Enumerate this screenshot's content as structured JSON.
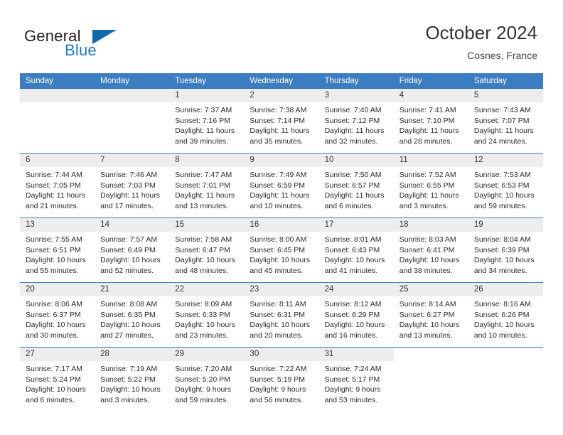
{
  "brand": {
    "word_one": "General",
    "word_two": "Blue",
    "triangle_color": "#1069ad",
    "blue_color": "#1f7bc1"
  },
  "header": {
    "title": "October 2024",
    "location": "Cosnes, France"
  },
  "theme": {
    "header_blue": "#3b7dc0",
    "daynum_gray": "#ededed",
    "text": "#2b2b2b"
  },
  "calendar": {
    "weekday_headers": [
      "Sunday",
      "Monday",
      "Tuesday",
      "Wednesday",
      "Thursday",
      "Friday",
      "Saturday"
    ],
    "labels": {
      "sunrise": "Sunrise:",
      "sunset": "Sunset:",
      "daylight": "Daylight:"
    },
    "weeks": [
      [
        {
          "day": "",
          "empty": true,
          "sunrise": "",
          "sunset": "",
          "daylight": ""
        },
        {
          "day": "",
          "empty": true,
          "sunrise": "",
          "sunset": "",
          "daylight": ""
        },
        {
          "day": "1",
          "sunrise": "Sunrise: 7:37 AM",
          "sunset": "Sunset: 7:16 PM",
          "daylight": "Daylight: 11 hours and 39 minutes."
        },
        {
          "day": "2",
          "sunrise": "Sunrise: 7:38 AM",
          "sunset": "Sunset: 7:14 PM",
          "daylight": "Daylight: 11 hours and 35 minutes."
        },
        {
          "day": "3",
          "sunrise": "Sunrise: 7:40 AM",
          "sunset": "Sunset: 7:12 PM",
          "daylight": "Daylight: 11 hours and 32 minutes."
        },
        {
          "day": "4",
          "sunrise": "Sunrise: 7:41 AM",
          "sunset": "Sunset: 7:10 PM",
          "daylight": "Daylight: 11 hours and 28 minutes."
        },
        {
          "day": "5",
          "sunrise": "Sunrise: 7:43 AM",
          "sunset": "Sunset: 7:07 PM",
          "daylight": "Daylight: 11 hours and 24 minutes."
        }
      ],
      [
        {
          "day": "6",
          "sunrise": "Sunrise: 7:44 AM",
          "sunset": "Sunset: 7:05 PM",
          "daylight": "Daylight: 11 hours and 21 minutes."
        },
        {
          "day": "7",
          "sunrise": "Sunrise: 7:46 AM",
          "sunset": "Sunset: 7:03 PM",
          "daylight": "Daylight: 11 hours and 17 minutes."
        },
        {
          "day": "8",
          "sunrise": "Sunrise: 7:47 AM",
          "sunset": "Sunset: 7:01 PM",
          "daylight": "Daylight: 11 hours and 13 minutes."
        },
        {
          "day": "9",
          "sunrise": "Sunrise: 7:49 AM",
          "sunset": "Sunset: 6:59 PM",
          "daylight": "Daylight: 11 hours and 10 minutes."
        },
        {
          "day": "10",
          "sunrise": "Sunrise: 7:50 AM",
          "sunset": "Sunset: 6:57 PM",
          "daylight": "Daylight: 11 hours and 6 minutes."
        },
        {
          "day": "11",
          "sunrise": "Sunrise: 7:52 AM",
          "sunset": "Sunset: 6:55 PM",
          "daylight": "Daylight: 11 hours and 3 minutes."
        },
        {
          "day": "12",
          "sunrise": "Sunrise: 7:53 AM",
          "sunset": "Sunset: 6:53 PM",
          "daylight": "Daylight: 10 hours and 59 minutes."
        }
      ],
      [
        {
          "day": "13",
          "sunrise": "Sunrise: 7:55 AM",
          "sunset": "Sunset: 6:51 PM",
          "daylight": "Daylight: 10 hours and 55 minutes."
        },
        {
          "day": "14",
          "sunrise": "Sunrise: 7:57 AM",
          "sunset": "Sunset: 6:49 PM",
          "daylight": "Daylight: 10 hours and 52 minutes."
        },
        {
          "day": "15",
          "sunrise": "Sunrise: 7:58 AM",
          "sunset": "Sunset: 6:47 PM",
          "daylight": "Daylight: 10 hours and 48 minutes."
        },
        {
          "day": "16",
          "sunrise": "Sunrise: 8:00 AM",
          "sunset": "Sunset: 6:45 PM",
          "daylight": "Daylight: 10 hours and 45 minutes."
        },
        {
          "day": "17",
          "sunrise": "Sunrise: 8:01 AM",
          "sunset": "Sunset: 6:43 PM",
          "daylight": "Daylight: 10 hours and 41 minutes."
        },
        {
          "day": "18",
          "sunrise": "Sunrise: 8:03 AM",
          "sunset": "Sunset: 6:41 PM",
          "daylight": "Daylight: 10 hours and 38 minutes."
        },
        {
          "day": "19",
          "sunrise": "Sunrise: 8:04 AM",
          "sunset": "Sunset: 6:39 PM",
          "daylight": "Daylight: 10 hours and 34 minutes."
        }
      ],
      [
        {
          "day": "20",
          "sunrise": "Sunrise: 8:06 AM",
          "sunset": "Sunset: 6:37 PM",
          "daylight": "Daylight: 10 hours and 30 minutes."
        },
        {
          "day": "21",
          "sunrise": "Sunrise: 8:08 AM",
          "sunset": "Sunset: 6:35 PM",
          "daylight": "Daylight: 10 hours and 27 minutes."
        },
        {
          "day": "22",
          "sunrise": "Sunrise: 8:09 AM",
          "sunset": "Sunset: 6:33 PM",
          "daylight": "Daylight: 10 hours and 23 minutes."
        },
        {
          "day": "23",
          "sunrise": "Sunrise: 8:11 AM",
          "sunset": "Sunset: 6:31 PM",
          "daylight": "Daylight: 10 hours and 20 minutes."
        },
        {
          "day": "24",
          "sunrise": "Sunrise: 8:12 AM",
          "sunset": "Sunset: 6:29 PM",
          "daylight": "Daylight: 10 hours and 16 minutes."
        },
        {
          "day": "25",
          "sunrise": "Sunrise: 8:14 AM",
          "sunset": "Sunset: 6:27 PM",
          "daylight": "Daylight: 10 hours and 13 minutes."
        },
        {
          "day": "26",
          "sunrise": "Sunrise: 8:16 AM",
          "sunset": "Sunset: 6:26 PM",
          "daylight": "Daylight: 10 hours and 10 minutes."
        }
      ],
      [
        {
          "day": "27",
          "sunrise": "Sunrise: 7:17 AM",
          "sunset": "Sunset: 5:24 PM",
          "daylight": "Daylight: 10 hours and 6 minutes."
        },
        {
          "day": "28",
          "sunrise": "Sunrise: 7:19 AM",
          "sunset": "Sunset: 5:22 PM",
          "daylight": "Daylight: 10 hours and 3 minutes."
        },
        {
          "day": "29",
          "sunrise": "Sunrise: 7:20 AM",
          "sunset": "Sunset: 5:20 PM",
          "daylight": "Daylight: 9 hours and 59 minutes."
        },
        {
          "day": "30",
          "sunrise": "Sunrise: 7:22 AM",
          "sunset": "Sunset: 5:19 PM",
          "daylight": "Daylight: 9 hours and 56 minutes."
        },
        {
          "day": "31",
          "sunrise": "Sunrise: 7:24 AM",
          "sunset": "Sunset: 5:17 PM",
          "daylight": "Daylight: 9 hours and 53 minutes."
        },
        {
          "day": "",
          "blank": true,
          "sunrise": "",
          "sunset": "",
          "daylight": ""
        },
        {
          "day": "",
          "blank": true,
          "sunrise": "",
          "sunset": "",
          "daylight": ""
        }
      ]
    ]
  }
}
